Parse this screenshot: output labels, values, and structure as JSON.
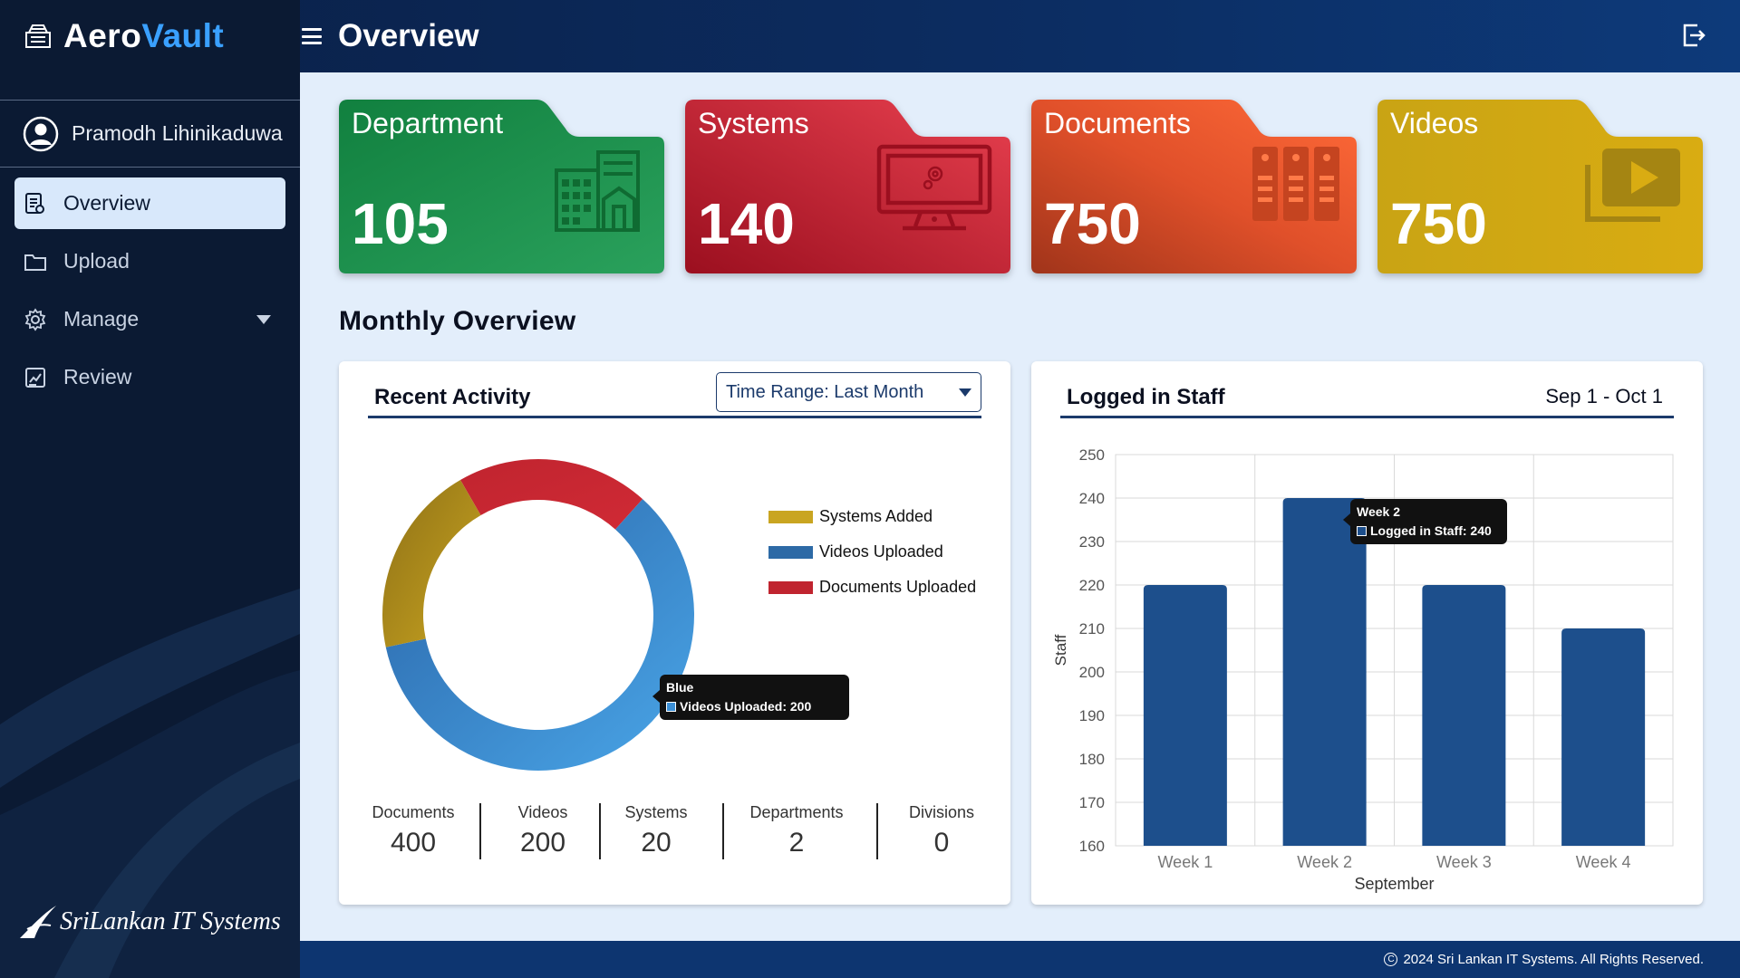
{
  "app": {
    "brand_part1": "Aero",
    "brand_part2": "Vault",
    "page_title": "Overview"
  },
  "user": {
    "name": "Pramodh Lihinikaduwa"
  },
  "nav": {
    "items": [
      {
        "label": "Overview",
        "icon": "document-list-icon",
        "active": true
      },
      {
        "label": "Upload",
        "icon": "folder-icon"
      },
      {
        "label": "Manage",
        "icon": "gear-icon"
      },
      {
        "label": "Review",
        "icon": "review-icon"
      }
    ]
  },
  "company": {
    "name": "SriLankan IT Systems"
  },
  "cards": [
    {
      "title": "Department",
      "value": "105",
      "icon": "building-icon",
      "color": "#1a8a4a"
    },
    {
      "title": "Systems",
      "value": "140",
      "icon": "monitor-icon",
      "color": "#d42b3f"
    },
    {
      "title": "Documents",
      "value": "750",
      "icon": "binders-icon",
      "color": "#f05a28"
    },
    {
      "title": "Videos",
      "value": "750",
      "icon": "video-icon",
      "color": "#cfa613"
    }
  ],
  "monthly_overview": {
    "title": "Monthly Overview"
  },
  "recent_activity": {
    "title": "Recent Activity",
    "time_range": "Time Range: Last Month",
    "legend": [
      {
        "label": "Systems Added",
        "color": "#c9a521"
      },
      {
        "label": "Videos Uploaded",
        "color": "#2d6aa6"
      },
      {
        "label": "Documents Uploaded",
        "color": "#c0242f"
      }
    ],
    "tooltip": {
      "title": "Blue",
      "text": "Videos Uploaded: 200"
    },
    "stats": [
      {
        "label": "Documents",
        "value": "400"
      },
      {
        "label": "Videos",
        "value": "200"
      },
      {
        "label": "Systems",
        "value": "20"
      },
      {
        "label": "Departments",
        "value": "2"
      },
      {
        "label": "Divisions",
        "value": "0"
      }
    ]
  },
  "logged_in_staff": {
    "title": "Logged in Staff",
    "date_range": "Sep 1  - Oct 1",
    "tooltip": {
      "title": "Week 2",
      "text": "Logged in Staff: 240"
    }
  },
  "footer": {
    "text": "2024 Sri Lankan IT Systems. All Rights Reserved."
  },
  "chart_data": [
    {
      "type": "pie",
      "title": "",
      "categories": [
        "Documents Uploaded",
        "Videos Uploaded",
        "Systems Added"
      ],
      "values": [
        20,
        60,
        20
      ],
      "colors": [
        "#c0242f",
        "#3b8fd6",
        "#b8981f"
      ]
    },
    {
      "type": "bar",
      "title": "",
      "categories": [
        "Week 1",
        "Week 2",
        "Week 3",
        "Week 4"
      ],
      "values": [
        220,
        240,
        220,
        210
      ],
      "xlabel": "September",
      "ylabel": "Staff",
      "ylim": [
        160,
        250
      ],
      "yticks": [
        160,
        170,
        180,
        190,
        200,
        210,
        220,
        230,
        240,
        250
      ],
      "grid": true,
      "color": "#1d4f8c"
    }
  ]
}
